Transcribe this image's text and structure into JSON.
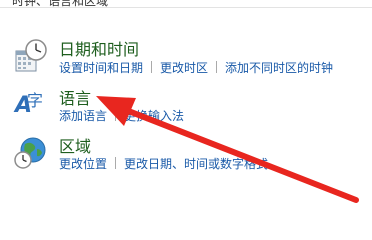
{
  "breadcrumb": "时钟、语言和区域",
  "categories": [
    {
      "title": "日期和时间",
      "icon": "calendar-clock-icon",
      "links": [
        "设置时间和日期",
        "更改时区",
        "添加不同时区的时钟"
      ]
    },
    {
      "title": "语言",
      "icon": "language-icon",
      "links": [
        "添加语言",
        "更换输入法"
      ]
    },
    {
      "title": "区域",
      "icon": "globe-clock-icon",
      "links": [
        "更改位置",
        "更改日期、时间或数字格式"
      ]
    }
  ],
  "colors": {
    "title": "#1e5e1e",
    "link": "#1a5aa8",
    "arrow": "#e8261f"
  }
}
